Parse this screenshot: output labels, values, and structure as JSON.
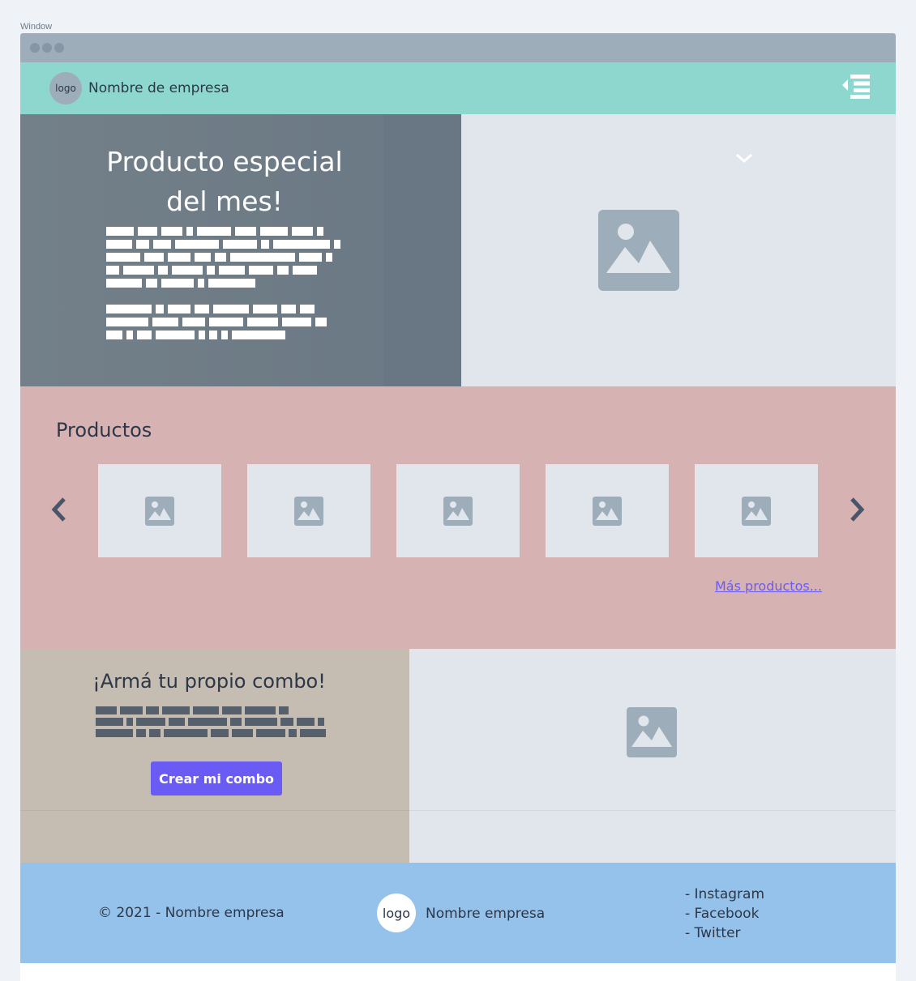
{
  "window": {
    "label": "Window"
  },
  "navbar": {
    "logo_text": "logo",
    "brand": "Nombre de empresa",
    "menu_icon": "menu-collapse-icon"
  },
  "hero": {
    "title_line1": "Producto especial",
    "title_line2": "del mes!",
    "text_placeholder": "redacted-text-lines",
    "image_icon": "image-placeholder-icon",
    "chevron_icon": "chevron-down-icon"
  },
  "products": {
    "title": "Productos",
    "card_count_visible": 5,
    "prev_icon": "chevron-left-icon",
    "next_icon": "chevron-right-icon",
    "more_link": "Más productos..."
  },
  "combo": {
    "title": "¡Armá tu propio combo!",
    "button": "Crear mi combo"
  },
  "footer": {
    "copyright": "© 2021 - Nombre empresa",
    "logo_text": "logo",
    "brand": "Nombre empresa",
    "social": [
      "- Instagram",
      "- Facebook",
      "- Twitter"
    ]
  },
  "colors": {
    "navbar": "#8dd7ce",
    "hero_left": "#6f7c87",
    "products_bg": "#d7b2b2",
    "combo_left": "#c5bdb1",
    "placeholder_bg": "#e1e6ed",
    "footer": "#94c2eb",
    "accent": "#6a5bf5"
  }
}
